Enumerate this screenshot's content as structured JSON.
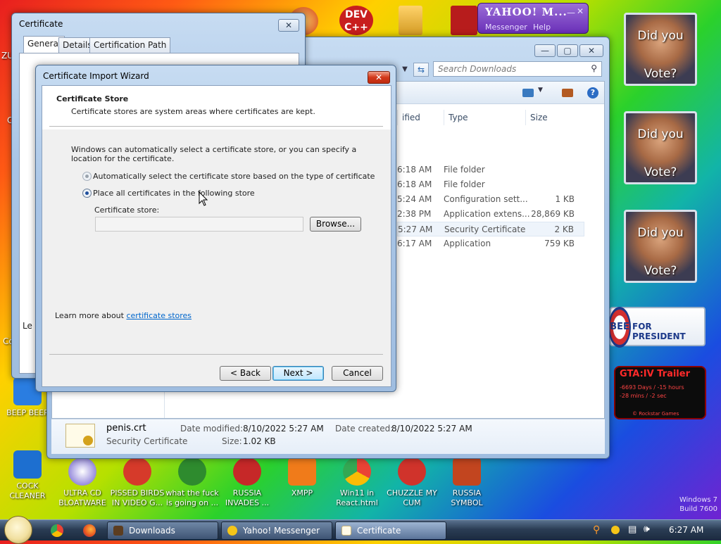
{
  "desktop": {
    "icons": [
      {
        "label": "BEEP BEEP",
        "color": "#2a7de1"
      },
      {
        "label": "COCK CLEANER",
        "color": "#1d6fd0"
      },
      {
        "label": "ULTRA CD BLOATWARE",
        "color": "#6a5acd"
      },
      {
        "label": "PISSED BIRDS IN VIDEO G...",
        "color": "#d63a2a"
      },
      {
        "label": "what the fuck is going on ...",
        "color": "#2e8b2e"
      },
      {
        "label": "RUSSIA INVADES ...",
        "color": "#c62828"
      },
      {
        "label": "XMPP",
        "color": "#f07b1a"
      },
      {
        "label": "Win11 in React.html",
        "color": "#4285f4"
      },
      {
        "label": "CHUZZLE MY CUM",
        "color": "#d0332b"
      },
      {
        "label": "RUSSIA SYMBOL",
        "color": "#c2451f"
      }
    ],
    "top_icons": [
      {
        "label": "DEV C++",
        "color": "#c81e1e"
      }
    ],
    "left_fragments": {
      "a": "ZU",
      "b": "C",
      "c": "Co"
    },
    "watermark": {
      "line1": "Windows 7",
      "line2": "Build 7600"
    }
  },
  "gadgets": {
    "vote_title": "Did you",
    "vote_sub": "Vote?",
    "president_text": "FOR PRESIDENT",
    "president_badge": "BEE",
    "gta_title": "GTA:IV Trailer",
    "gta_line1": "-6693 Days / -15 hours",
    "gta_line2": "-28 mins / -2 sec",
    "gta_footer": "© Rockstar Games"
  },
  "yahoo": {
    "logo": "YAHOO! M...",
    "menu_messenger": "Messenger",
    "menu_help": "Help"
  },
  "explorer": {
    "search_placeholder": "Search Downloads",
    "columns": {
      "modified": "ified",
      "type": "Type",
      "size": "Size"
    },
    "rows": [
      {
        "time": "6:18 AM",
        "type": "File folder",
        "size": ""
      },
      {
        "time": "6:18 AM",
        "type": "File folder",
        "size": ""
      },
      {
        "time": "5:24 AM",
        "type": "Configuration sett...",
        "size": "1 KB"
      },
      {
        "time": "2:38 PM",
        "type": "Application extens...",
        "size": "28,869 KB"
      },
      {
        "time": "5:27 AM",
        "type": "Security Certificate",
        "size": "2 KB"
      },
      {
        "time": "6:17 AM",
        "type": "Application",
        "size": "759 KB"
      }
    ],
    "details": {
      "filename": "penis.crt",
      "filetype": "Security Certificate",
      "modified_label": "Date modified:",
      "modified_value": "8/10/2022 5:27 AM",
      "created_label": "Date created:",
      "created_value": "8/10/2022 5:27 AM",
      "size_label": "Size:",
      "size_value": "1.02 KB"
    }
  },
  "certificate": {
    "title": "Certificate",
    "tabs": [
      "General",
      "Details",
      "Certification Path"
    ],
    "fragment_le": "Le"
  },
  "wizard": {
    "title": "Certificate Import Wizard",
    "header_title": "Certificate Store",
    "header_desc": "Certificate stores are system areas where certificates are kept.",
    "intro": "Windows can automatically select a certificate store, or you can specify a location for the certificate.",
    "option_auto": "Automatically select the certificate store based on the type of certificate",
    "option_manual": "Place all certificates in the following store",
    "store_label": "Certificate store:",
    "store_value": "",
    "browse": "Browse...",
    "learn_prefix": "Learn more about ",
    "learn_link": "certificate stores",
    "back": "< Back",
    "next": "Next >",
    "cancel": "Cancel"
  },
  "taskbar": {
    "buttons": [
      {
        "label": "Downloads",
        "active": false
      },
      {
        "label": "Yahoo! Messenger",
        "active": false
      },
      {
        "label": "Certificate",
        "active": true
      }
    ],
    "clock": "6:27 AM"
  }
}
